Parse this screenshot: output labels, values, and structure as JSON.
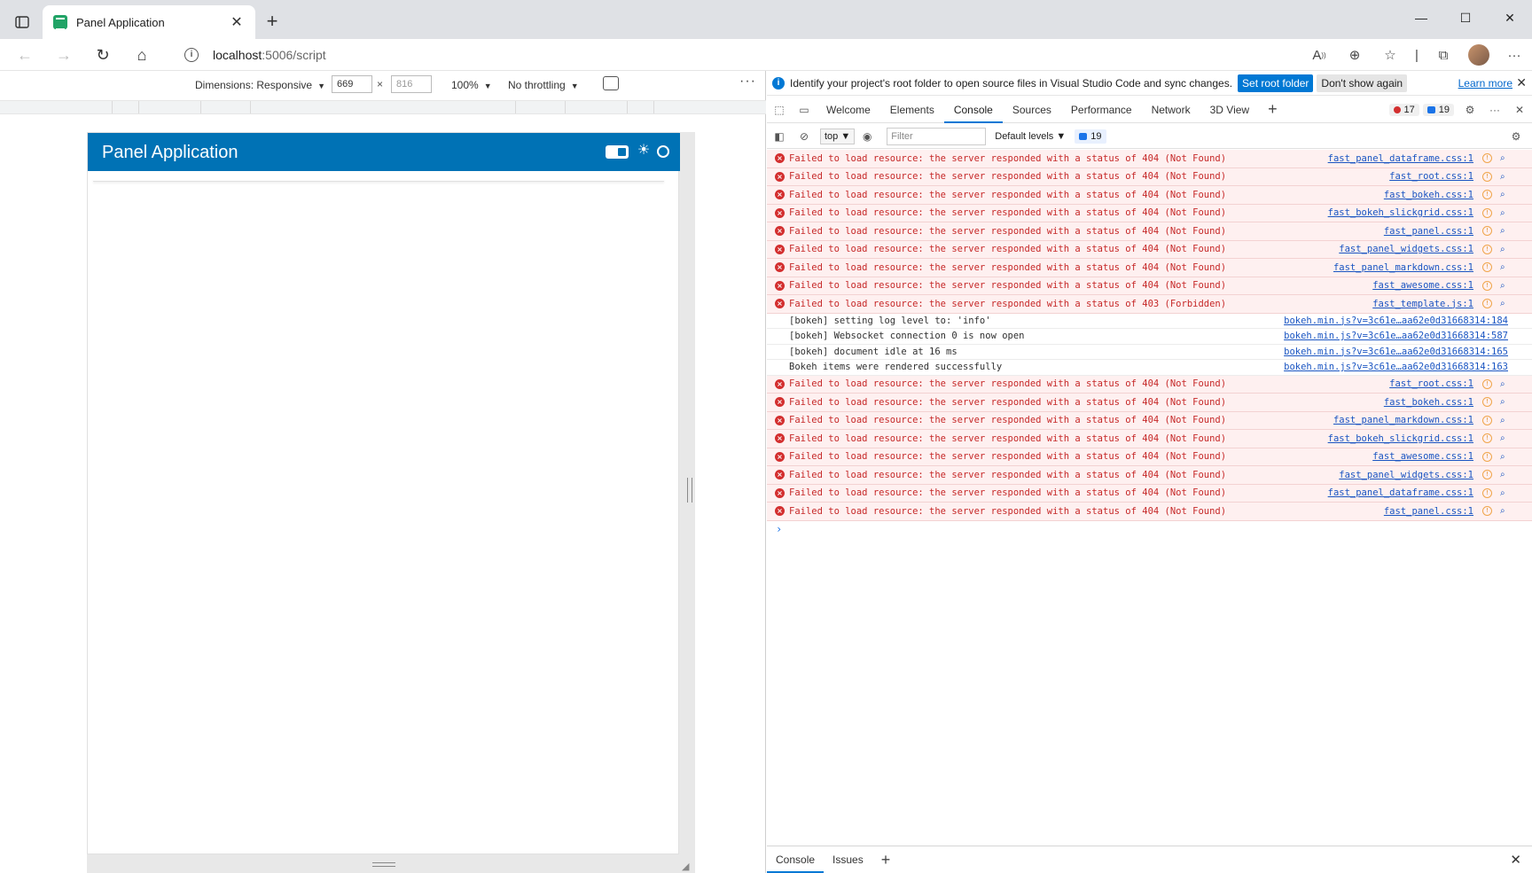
{
  "browser": {
    "tab_title": "Panel Application",
    "url_host": "localhost",
    "url_rest": ":5006/script",
    "icons": [
      "tab-actions-icon",
      "back-icon",
      "forward-icon",
      "reload-icon",
      "home-icon",
      "read-aloud-icon",
      "zoom-icon",
      "favorite-icon",
      "collections-icon",
      "profile-avatar",
      "more-icon"
    ]
  },
  "device_toolbar": {
    "dimensions_label": "Dimensions: Responsive",
    "width": "669",
    "height": "816",
    "times": "×",
    "zoom": "100%",
    "throttling": "No throttling"
  },
  "app": {
    "title": "Panel Application",
    "header_color": "#0072b5"
  },
  "devtools": {
    "infobar": {
      "message": "Identify your project's root folder to open source files in Visual Studio Code and sync changes.",
      "set_root_label": "Set root folder",
      "dismiss_label": "Don't show again",
      "learn_more": "Learn more"
    },
    "tabs": [
      "Welcome",
      "Elements",
      "Console",
      "Sources",
      "Performance",
      "Network",
      "3D View"
    ],
    "active_tab": "Console",
    "error_count": "17",
    "info_count": "19",
    "console_toolbar": {
      "context": "top",
      "filter_placeholder": "Filter",
      "levels": "Default levels",
      "message_count": "19"
    },
    "logs": [
      {
        "type": "error",
        "msg": "Failed to load resource: the server responded with a status of 404 (Not Found)",
        "src": "fast_panel_dataframe.css:1"
      },
      {
        "type": "error",
        "msg": "Failed to load resource: the server responded with a status of 404 (Not Found)",
        "src": "fast_root.css:1"
      },
      {
        "type": "error",
        "msg": "Failed to load resource: the server responded with a status of 404 (Not Found)",
        "src": "fast_bokeh.css:1"
      },
      {
        "type": "error",
        "msg": "Failed to load resource: the server responded with a status of 404 (Not Found)",
        "src": "fast_bokeh_slickgrid.css:1"
      },
      {
        "type": "error",
        "msg": "Failed to load resource: the server responded with a status of 404 (Not Found)",
        "src": "fast_panel.css:1"
      },
      {
        "type": "error",
        "msg": "Failed to load resource: the server responded with a status of 404 (Not Found)",
        "src": "fast_panel_widgets.css:1"
      },
      {
        "type": "error",
        "msg": "Failed to load resource: the server responded with a status of 404 (Not Found)",
        "src": "fast_panel_markdown.css:1"
      },
      {
        "type": "error",
        "msg": "Failed to load resource: the server responded with a status of 404 (Not Found)",
        "src": "fast_awesome.css:1"
      },
      {
        "type": "error",
        "msg": "Failed to load resource: the server responded with a status of 403 (Forbidden)",
        "src": "fast_template.js:1"
      },
      {
        "type": "info",
        "msg": "[bokeh] setting log level to: 'info'",
        "src": "bokeh.min.js?v=3c61e…aa62e0d31668314:184"
      },
      {
        "type": "info",
        "msg": "[bokeh] Websocket connection 0 is now open",
        "src": "bokeh.min.js?v=3c61e…aa62e0d31668314:587"
      },
      {
        "type": "info",
        "msg": "[bokeh] document idle at 16 ms",
        "src": "bokeh.min.js?v=3c61e…aa62e0d31668314:165"
      },
      {
        "type": "info",
        "msg": "Bokeh items were rendered successfully",
        "src": "bokeh.min.js?v=3c61e…aa62e0d31668314:163"
      },
      {
        "type": "error",
        "msg": "Failed to load resource: the server responded with a status of 404 (Not Found)",
        "src": "fast_root.css:1"
      },
      {
        "type": "error",
        "msg": "Failed to load resource: the server responded with a status of 404 (Not Found)",
        "src": "fast_bokeh.css:1"
      },
      {
        "type": "error",
        "msg": "Failed to load resource: the server responded with a status of 404 (Not Found)",
        "src": "fast_panel_markdown.css:1"
      },
      {
        "type": "error",
        "msg": "Failed to load resource: the server responded with a status of 404 (Not Found)",
        "src": "fast_bokeh_slickgrid.css:1"
      },
      {
        "type": "error",
        "msg": "Failed to load resource: the server responded with a status of 404 (Not Found)",
        "src": "fast_awesome.css:1"
      },
      {
        "type": "error",
        "msg": "Failed to load resource: the server responded with a status of 404 (Not Found)",
        "src": "fast_panel_widgets.css:1"
      },
      {
        "type": "error",
        "msg": "Failed to load resource: the server responded with a status of 404 (Not Found)",
        "src": "fast_panel_dataframe.css:1"
      },
      {
        "type": "error",
        "msg": "Failed to load resource: the server responded with a status of 404 (Not Found)",
        "src": "fast_panel.css:1"
      }
    ],
    "drawer_tabs": [
      "Console",
      "Issues"
    ]
  },
  "colors": {
    "accent": "#0078d4",
    "error_bg": "#fef0f0",
    "error_text": "#c62828",
    "link": "#1a55c2"
  }
}
